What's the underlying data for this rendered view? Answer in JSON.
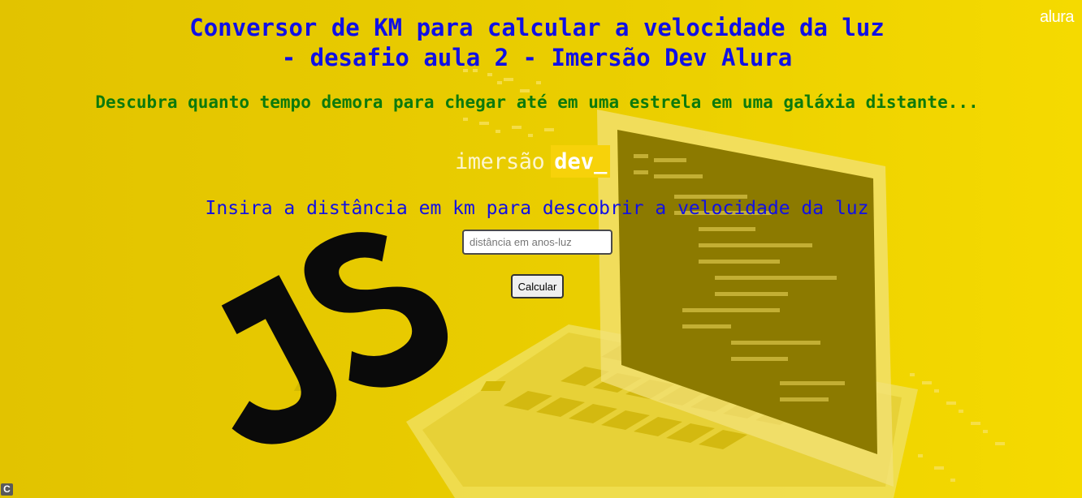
{
  "header": {
    "title_line1": "Conversor de KM para calcular a velocidade da luz",
    "title_line2": "- desafio aula 2 - Imersão Dev Alura",
    "subtitle": "Descubra quanto tempo demora para chegar até em uma estrela em uma galáxia distante..."
  },
  "brand": {
    "logo": "alura",
    "imersao": "imersão",
    "dev": "dev_"
  },
  "form": {
    "instruction": "Insira a distância em km para descobrir a velocidade da luz",
    "input_placeholder": "distância em anos-luz",
    "input_value": "",
    "button_label": "Calcular"
  },
  "background": {
    "js_logo": "JS",
    "decoration": "laptop-illustration"
  },
  "corner": {
    "icon_letter": "C",
    "icon_name": "c-badge-icon"
  },
  "colors": {
    "background": "#e6c800",
    "title": "#1010e6",
    "subtitle": "#0c7a0c",
    "brand_box": "#f7d20a"
  }
}
